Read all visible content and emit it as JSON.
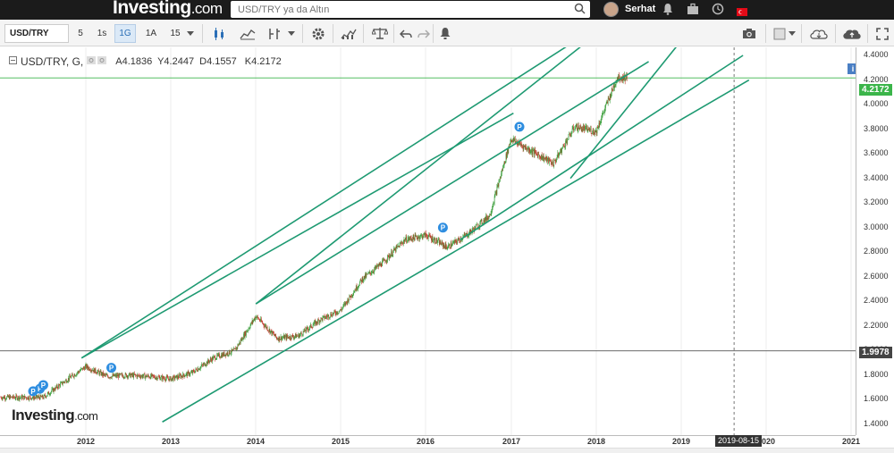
{
  "header": {
    "logo_main": "Investing",
    "logo_suffix": ".com",
    "search_placeholder": "USD/TRY ya da Altın",
    "username": "Serhat"
  },
  "toolbar": {
    "symbol": "USD/TRY",
    "timeframes": [
      "5",
      "1s",
      "1G",
      "1A",
      "15"
    ],
    "active_timeframe": "1G"
  },
  "legend": {
    "title": "USD/TRY, G,",
    "open": "A4.1836",
    "high": "Y4.2447",
    "low": "D4.1557",
    "close": "K4.2172"
  },
  "colors": {
    "candle_up": "#3a9e3a",
    "candle_down": "#c0392b",
    "trendline": "#1e9a72",
    "last_price": "#3bb54a",
    "hline_gray": "#555555",
    "pin": "#2f8ee0"
  },
  "price_axis": {
    "ticks": [
      "4.4000",
      "4.2000",
      "4.0000",
      "3.8000",
      "3.6000",
      "3.4000",
      "3.2000",
      "3.0000",
      "2.8000",
      "2.6000",
      "2.4000",
      "2.2000",
      "2.0000",
      "1.8000",
      "1.6000",
      "1.4000"
    ],
    "last_price_label": "4.2172",
    "hline_label": "1.9978"
  },
  "time_axis": {
    "ticks": [
      "2012",
      "2013",
      "2014",
      "2015",
      "2016",
      "2017",
      "2018",
      "2019",
      "2020",
      "2021"
    ],
    "crosshair_date": "2019-08-15"
  },
  "event_pins": [
    "P",
    "P",
    "P",
    "P",
    "P"
  ],
  "watermark": {
    "main": "Investing",
    "suffix": ".com"
  },
  "chart_data": {
    "type": "candlestick",
    "symbol": "USD/TRY",
    "interval": "daily",
    "ylim": [
      1.35,
      4.55
    ],
    "x": [
      "2011-07",
      "2011-10",
      "2012-01",
      "2012-04",
      "2012-07",
      "2012-10",
      "2013-01",
      "2013-04",
      "2013-07",
      "2013-10",
      "2014-01",
      "2014-04",
      "2014-07",
      "2014-10",
      "2015-01",
      "2015-04",
      "2015-07",
      "2015-10",
      "2016-01",
      "2016-04",
      "2016-07",
      "2016-10",
      "2017-01",
      "2017-04",
      "2017-07",
      "2017-10",
      "2018-01",
      "2018-04"
    ],
    "close": [
      1.62,
      1.75,
      1.87,
      1.79,
      1.8,
      1.79,
      1.77,
      1.82,
      1.94,
      2.0,
      2.28,
      2.1,
      2.12,
      2.25,
      2.33,
      2.58,
      2.72,
      2.9,
      2.94,
      2.84,
      2.95,
      3.1,
      3.72,
      3.62,
      3.52,
      3.82,
      3.78,
      4.22
    ],
    "last_price": 4.2172,
    "horizontal_line": 1.9978
  }
}
